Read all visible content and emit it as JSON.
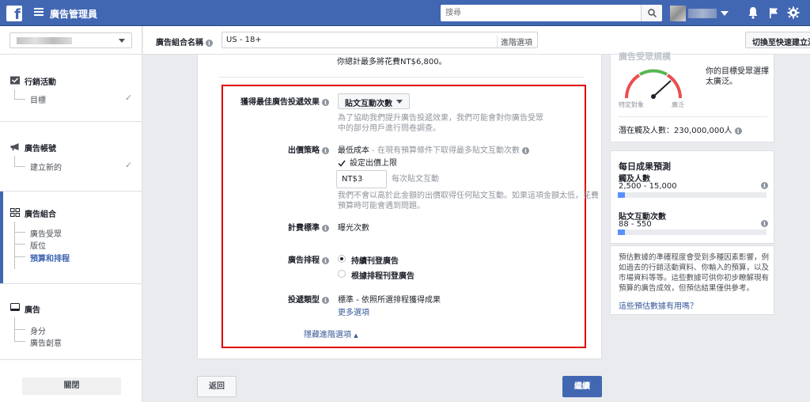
{
  "topbar": {
    "app_title": "廣告管理員",
    "search_placeholder": "搜尋"
  },
  "namebar": {
    "label": "廣告組合名稱",
    "value": "US - 18+",
    "advanced": "進階選項",
    "switch_button": "切換至快速建立流"
  },
  "sidebar": {
    "sections": [
      {
        "title": "行銷活動",
        "items": [
          "目標"
        ]
      },
      {
        "title": "廣告帳號",
        "items": [
          "建立新的"
        ]
      },
      {
        "title": "廣告組合",
        "items": [
          "廣告受眾",
          "版位",
          "預算和排程"
        ]
      },
      {
        "title": "廣告",
        "items": [
          "身分",
          "廣告創意"
        ]
      }
    ],
    "close_button": "關閉"
  },
  "main": {
    "budget_note": "你總計最多將花費NT$6,800。",
    "optimization": {
      "label": "獲得最佳廣告投遞效果",
      "value": "貼文互動次數",
      "help": [
        "為了協助我們提升廣告投遞效果，我們可能會對你廣告受眾",
        "中的部分用戶進行問卷調查。"
      ]
    },
    "bid_strategy": {
      "label": "出價策略",
      "value": "最低成本",
      "detail": " - 在現有預算條件下取得最多貼文互動次數",
      "cap_label": "設定出價上限",
      "bid_value": "NT$3",
      "bid_unit": "每次貼文互動",
      "help": [
        "我們不會以高於此金額的出價取得任何貼文互動。如果這項金額太低，花費",
        "預算時可能會遇到問題。"
      ]
    },
    "billing": {
      "label": "計費標準",
      "value": "曝光次數"
    },
    "schedule": {
      "label": "廣告排程",
      "options": [
        "持續刊登廣告",
        "根據排程刊登廣告"
      ],
      "selected": 0
    },
    "delivery": {
      "label": "投遞類型",
      "value": "標準 - 依照所選排程獲得成果",
      "more": "更多選項"
    },
    "hide_advanced": "隱藏進階選項"
  },
  "footer": {
    "back": "返回",
    "next": "繼續"
  },
  "audience_panel": {
    "title": "廣告受眾規模",
    "gauge_left": "特定對象",
    "gauge_right": "廣泛",
    "summary": "你的目標受眾選擇太廣泛。",
    "potential_reach": "潛在觸及人數：230,000,000人"
  },
  "daily_panel": {
    "title": "每日成果預測",
    "reach_label": "觸及人數",
    "reach_value": "2,500 - 15,000",
    "reach_fill": 0.05,
    "engage_label": "貼文互動次數",
    "engage_value": "88 - 550",
    "engage_fill": 0.05
  },
  "estimate_note": {
    "text": "預估數據的準確程度會受到多種因素影響，例如過去的行銷活動資料、你輸入的預算，以及市場資料等等。這些數據可供你初步瞭解現有預算的廣告成效，但預估結果僅供參考。",
    "link": "這些預估數據有用嗎？"
  },
  "colors": {
    "brand": "#4267b2",
    "highlight": "#dd0000",
    "bar": "#5890ff"
  }
}
